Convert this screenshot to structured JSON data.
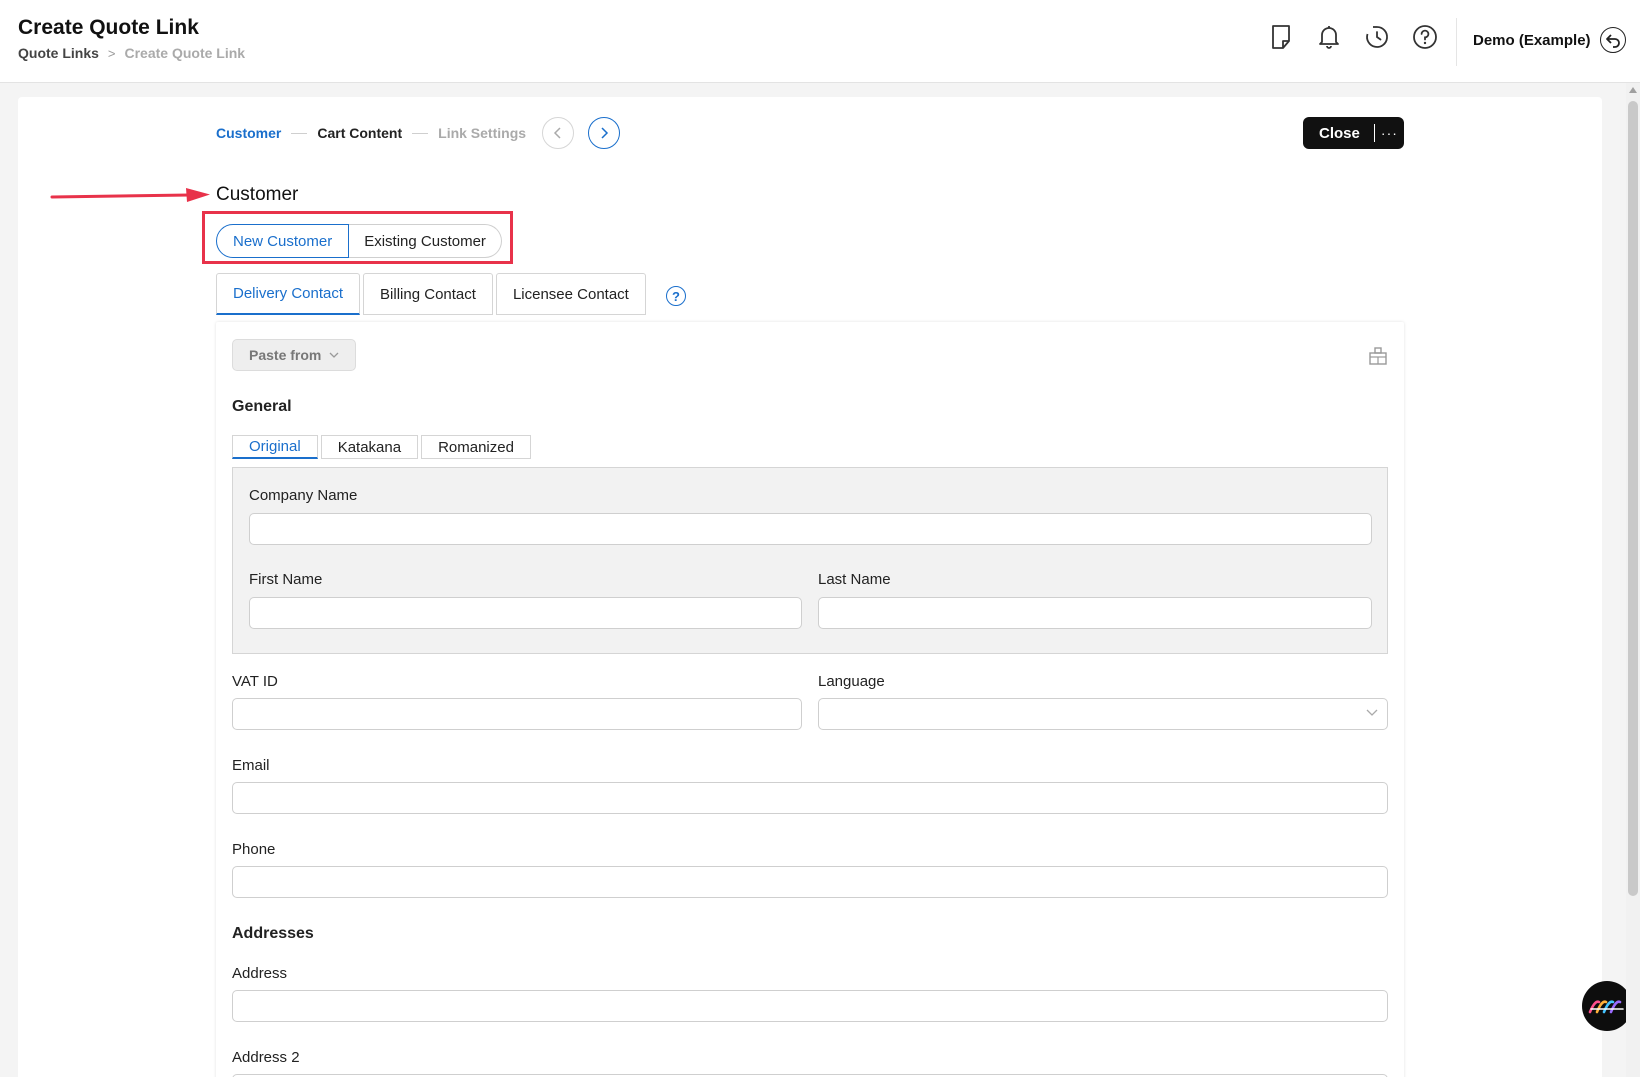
{
  "header": {
    "title": "Create Quote Link",
    "breadcrumb": {
      "parent": "Quote Links",
      "separator": ">",
      "current": "Create Quote Link"
    },
    "icons": [
      "document-icon",
      "bell-icon",
      "history-icon",
      "help-icon"
    ],
    "account_name": "Demo (Example)"
  },
  "stepper": {
    "steps": [
      "Customer",
      "Cart Content",
      "Link Settings"
    ],
    "active_step": "Customer"
  },
  "actions": {
    "close_label": "Close",
    "more_label": "···"
  },
  "customer": {
    "title": "Customer",
    "type_options": [
      "New Customer",
      "Existing Customer"
    ],
    "selected_type": "New Customer"
  },
  "contact_tabs": [
    "Delivery Contact",
    "Billing Contact",
    "Licensee Contact"
  ],
  "active_contact_tab": "Delivery Contact",
  "form": {
    "paste_from_label": "Paste from",
    "general_heading": "General",
    "name_tabs": [
      "Original",
      "Katakana",
      "Romanized"
    ],
    "active_name_tab": "Original",
    "company_name_label": "Company Name",
    "company_name_value": "",
    "first_name_label": "First Name",
    "first_name_value": "",
    "last_name_label": "Last Name",
    "last_name_value": "",
    "vat_id_label": "VAT ID",
    "vat_id_value": "",
    "language_label": "Language",
    "language_value": "",
    "email_label": "Email",
    "email_value": "",
    "phone_label": "Phone",
    "phone_value": "",
    "addresses_heading": "Addresses",
    "address_label": "Address",
    "address_value": "",
    "address2_label": "Address 2",
    "address2_value": ""
  },
  "colors": {
    "accent": "#1a6fcc",
    "highlight": "#e8324a",
    "dark_button": "#111111"
  }
}
